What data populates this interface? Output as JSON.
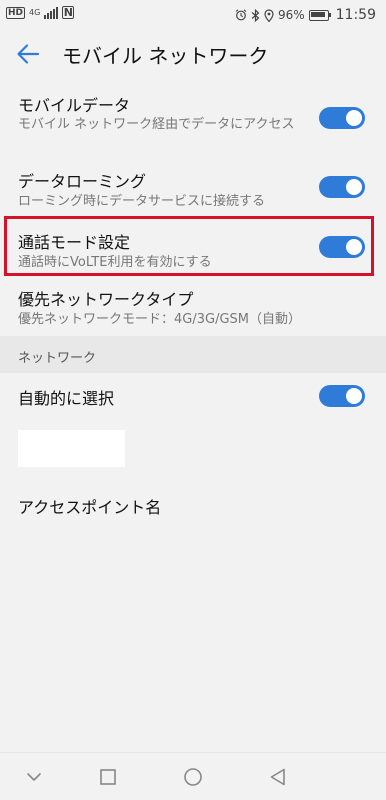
{
  "status_bar": {
    "hd": "HD",
    "network_type": "4G",
    "nfc": "N",
    "battery": "96%",
    "time": "11:59",
    "icons": [
      "alarm-icon",
      "bluetooth-icon",
      "location-icon",
      "signal-icon",
      "battery-icon"
    ]
  },
  "header": {
    "title": "モバイル ネットワーク",
    "back_icon": "arrow-left-icon"
  },
  "settings": {
    "mobile_data": {
      "title": "モバイルデータ",
      "subtitle": "モバイル ネットワーク経由でデータにアクセス",
      "enabled": true
    },
    "data_roaming": {
      "title": "データローミング",
      "subtitle": "ローミング時にデータサービスに接続する",
      "enabled": true
    },
    "call_mode": {
      "title": "通話モード設定",
      "subtitle": "通話時にVoLTE利用を有効にする",
      "enabled": true
    },
    "preferred_network": {
      "title": "優先ネットワークタイプ",
      "subtitle": "優先ネットワークモード：4G/3G/GSM（自動）"
    }
  },
  "network_section": {
    "header": "ネットワーク",
    "auto_select": {
      "title": "自動的に選択",
      "enabled": true
    },
    "apn": {
      "title": "アクセスポイント名"
    }
  },
  "nav_bar": {
    "buttons": [
      "chevron-down-icon",
      "square-icon",
      "circle-icon",
      "triangle-back-icon"
    ]
  },
  "colors": {
    "accent": "#2f7cd8",
    "highlight": "#d6122b",
    "background": "#f2f2f2"
  }
}
